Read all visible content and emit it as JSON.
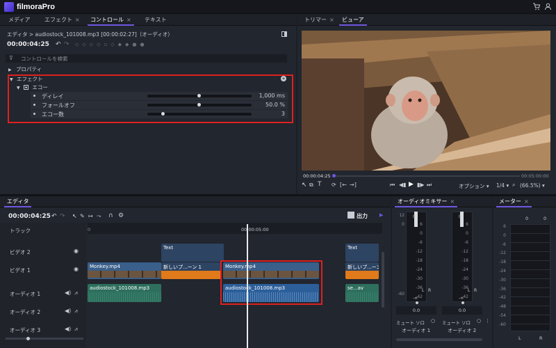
{
  "app": {
    "name": "filmoraPro"
  },
  "colors": {
    "accent": "#6e57e0",
    "highlight": "#e02020",
    "video_clip": "#3a5f8a",
    "audio_clip": "#2e6f5d",
    "orange": "#e07a1a"
  },
  "left_tabs": [
    {
      "label": "メディア",
      "closable": false
    },
    {
      "label": "エフェクト",
      "closable": true
    },
    {
      "label": "コントロール",
      "closable": true
    },
    {
      "label": "テキスト",
      "closable": false
    }
  ],
  "controls": {
    "breadcrumb": "エディタ > audiostock_101008.mp3 [00:00:02:27]（オーディオ）",
    "timecode": "00:00:04:25",
    "search_placeholder": "コントロールを検索",
    "properties": "プロパティ",
    "effects": "エフェクト",
    "echo": "エコー",
    "params": [
      {
        "label": "ディレイ",
        "value": "1,000 ms",
        "level": 0.5
      },
      {
        "label": "フォールオフ",
        "value": "50.0 %",
        "level": 0.5
      },
      {
        "label": "エコー数",
        "value": "3",
        "level": 0.15
      }
    ]
  },
  "right_tabs": [
    {
      "label": "トリマー",
      "closable": true
    },
    {
      "label": "ビューア",
      "closable": false
    }
  ],
  "viewer": {
    "current_time": "00:00:04:25",
    "end_time": "00:05:00:00",
    "options": "オプション ▾",
    "quality": "1/4 ▾",
    "zoom": "(66.5%) ▾"
  },
  "editor": {
    "tab": "エディタ",
    "timecode": "00:00:04:25",
    "export": "出力",
    "ruler_start": "0",
    "ruler_mark": "00:00:05:00",
    "tracks": [
      "トラック",
      "ビデオ 2",
      "ビデオ 1",
      "オーディオ 1",
      "オーディオ 2",
      "オーディオ 3"
    ],
    "clips": {
      "text1": "Text",
      "text2": "Text",
      "monkey1": "Monkey.mp4",
      "comp1": "新しいプ...ーン 1",
      "monkey2": "Monkey.mp4",
      "comp2": "新しいプ...ーン",
      "audio1": "audiostock_101008.mp3",
      "audio2": "audiostock_101008.mp3",
      "audio3": "se...av"
    }
  },
  "mixer": {
    "tab": "オーディオミキサー",
    "scale": [
      "12",
      "6",
      "0",
      "-6",
      "-12",
      "-18",
      "-24",
      "-30",
      "-36",
      "-42",
      "-48",
      "-60"
    ],
    "channels": [
      {
        "name": "オーディオ 1",
        "top_value": "0",
        "db": "0.0",
        "mute": "ミュート",
        "solo": "ソロ"
      },
      {
        "name": "オーディオ 2",
        "top_value": "0",
        "db": "0.0",
        "mute": "ミュート",
        "solo": "ソロ"
      }
    ],
    "lr": [
      "L",
      "R"
    ],
    "minus_inf": "-∞"
  },
  "meter": {
    "tab": "メーター",
    "top_values": [
      "0",
      "0"
    ],
    "scale": [
      "6",
      "0",
      "-6",
      "-12",
      "-18",
      "-24",
      "-30",
      "-36",
      "-42",
      "-48",
      "-54",
      "-60"
    ],
    "lr": [
      "L",
      "R"
    ]
  }
}
